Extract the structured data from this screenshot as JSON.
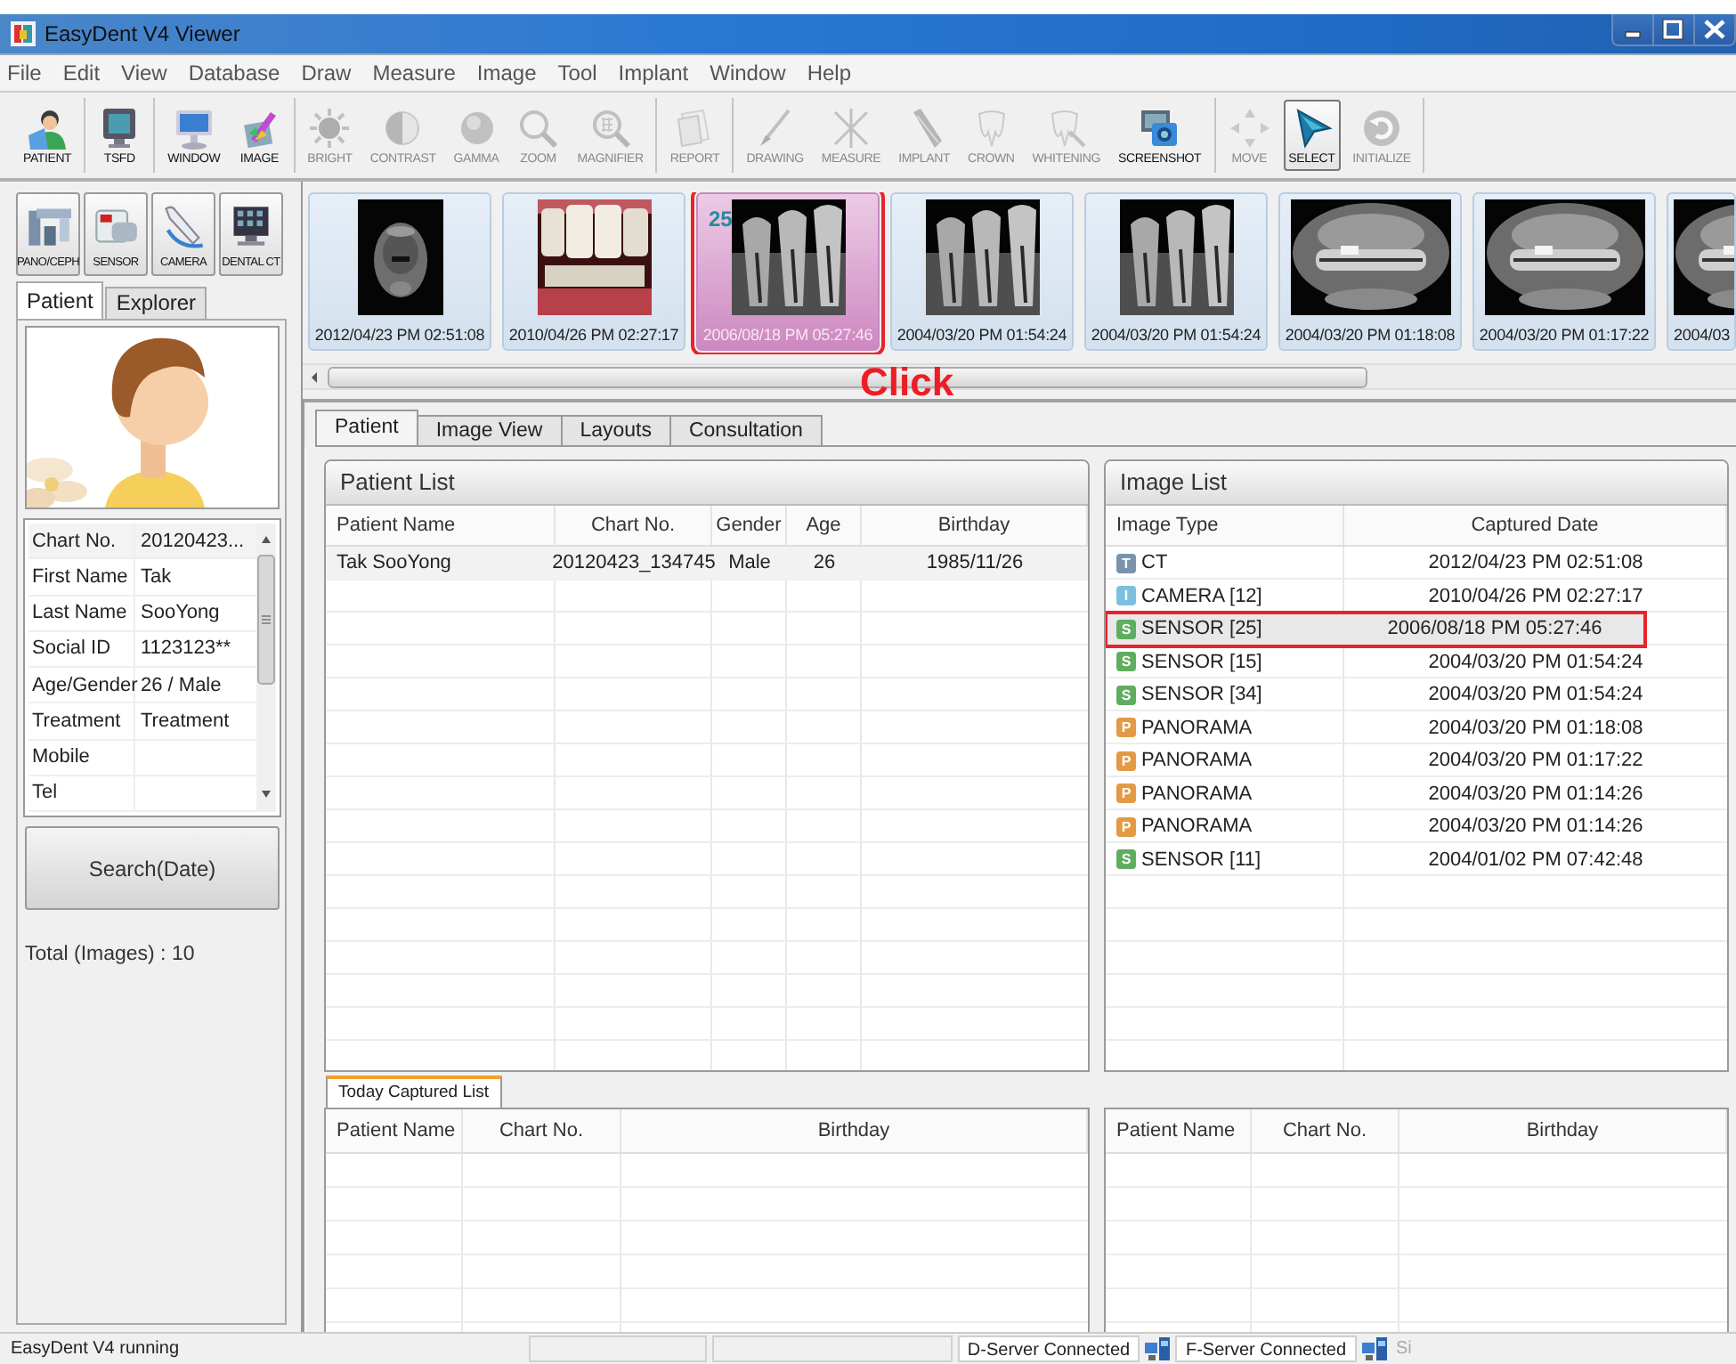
{
  "window": {
    "title": "EasyDent V4 Viewer"
  },
  "menu": [
    "File",
    "Edit",
    "View",
    "Database",
    "Draw",
    "Measure",
    "Image",
    "Tool",
    "Implant",
    "Window",
    "Help"
  ],
  "toolbar": {
    "groups": [
      [
        {
          "label": "PATIENT",
          "disabled": false,
          "selected": false
        }
      ],
      [
        {
          "label": "TSFD",
          "disabled": false,
          "selected": false
        }
      ],
      [
        {
          "label": "WINDOW",
          "disabled": false,
          "selected": false
        },
        {
          "label": "IMAGE",
          "disabled": false,
          "selected": false
        }
      ],
      [
        {
          "label": "BRIGHT",
          "disabled": true,
          "selected": false
        },
        {
          "label": "CONTRAST",
          "disabled": true,
          "selected": false
        },
        {
          "label": "GAMMA",
          "disabled": true,
          "selected": false
        },
        {
          "label": "ZOOM",
          "disabled": true,
          "selected": false
        },
        {
          "label": "MAGNIFIER",
          "disabled": true,
          "selected": false
        }
      ],
      [
        {
          "label": "REPORT",
          "disabled": true,
          "selected": false
        }
      ],
      [
        {
          "label": "DRAWING",
          "disabled": true,
          "selected": false
        },
        {
          "label": "MEASURE",
          "disabled": true,
          "selected": false
        },
        {
          "label": "IMPLANT",
          "disabled": true,
          "selected": false
        },
        {
          "label": "CROWN",
          "disabled": true,
          "selected": false
        },
        {
          "label": "WHITENING",
          "disabled": true,
          "selected": false
        },
        {
          "label": "SCREENSHOT",
          "disabled": false,
          "selected": false
        }
      ],
      [
        {
          "label": "MOVE",
          "disabled": true,
          "selected": false
        },
        {
          "label": "SELECT",
          "disabled": false,
          "selected": true
        },
        {
          "label": "INITIALIZE",
          "disabled": true,
          "selected": false
        }
      ]
    ]
  },
  "devices": [
    "PANO/CEPH",
    "SENSOR",
    "CAMERA",
    "DENTAL CT"
  ],
  "left_tabs": [
    {
      "label": "Patient",
      "selected": true
    },
    {
      "label": "Explorer",
      "selected": false
    }
  ],
  "patient_info": [
    {
      "field": "Chart No.",
      "value": "20120423..."
    },
    {
      "field": "First Name",
      "value": "Tak"
    },
    {
      "field": "Last Name",
      "value": "SooYong"
    },
    {
      "field": "Social ID",
      "value": "1123123**"
    },
    {
      "field": "Age/Gender",
      "value": "26 / Male"
    },
    {
      "field": "Treatment",
      "value": "Treatment"
    },
    {
      "field": "Mobile"
    },
    {
      "field": "Tel"
    }
  ],
  "search_button": "Search(Date)",
  "total": "Total (Images) : 10",
  "thumbnails": [
    {
      "kind": "ct",
      "date": "2012/04/23 PM 02:51:08",
      "selected": false,
      "highlighted": false
    },
    {
      "date": "2010/04/26 PM 02:27:17",
      "selected": false,
      "highlighted": false
    },
    {
      "kind": "periapical",
      "badge": "25",
      "date": "2006/08/18 PM 05:27:46",
      "selected": true,
      "highlighted": true
    },
    {
      "kind": "periapical",
      "date": "2004/03/20 PM 01:54:24",
      "selected": false,
      "highlighted": false
    },
    {
      "kind": "periapical",
      "date": "2004/03/20 PM 01:54:24",
      "selected": false,
      "highlighted": false
    },
    {
      "kind": "panorama",
      "date": "2004/03/20 PM 01:18:08",
      "selected": false,
      "highlighted": false
    },
    {
      "kind": "panorama",
      "date": "2004/03/20 PM 01:17:22",
      "selected": false,
      "highlighted": false
    },
    {
      "kind": "panorama",
      "date": "2004/03",
      "selected": false,
      "highlighted": false
    }
  ],
  "click_label": "Click",
  "tabs": [
    {
      "label": "Patient",
      "selected": true
    },
    {
      "label": "Image View",
      "selected": false
    },
    {
      "label": "Layouts",
      "selected": false
    },
    {
      "label": "Consultation",
      "selected": false
    }
  ],
  "patient_list": {
    "title": "Patient List",
    "columns": [
      "Patient Name",
      "Chart No.",
      "Gender",
      "Age",
      "Birthday"
    ],
    "rows": [
      [
        "Tak SooYong",
        "20120423_134745",
        "Male",
        "26",
        "1985/11/26"
      ]
    ]
  },
  "image_list": {
    "title": "Image List",
    "columns": [
      "Image Type",
      "Captured Date"
    ],
    "rows": [
      {
        "letter": "T",
        "color": "#7a93ad",
        "type": "CT",
        "date": "2012/04/23 PM 02:51:08",
        "selected": false,
        "highlighted": false
      },
      {
        "letter": "I",
        "color": "#7cc0e0",
        "type": "CAMERA [12]",
        "date": "2010/04/26 PM 02:27:17",
        "selected": false,
        "highlighted": false
      },
      {
        "letter": "S",
        "color": "#5fae5f",
        "type": "SENSOR [25]",
        "date": "2006/08/18 PM 05:27:46",
        "selected": true,
        "highlighted": true
      },
      {
        "letter": "S",
        "color": "#5fae5f",
        "type": "SENSOR [15]",
        "date": "2004/03/20 PM 01:54:24",
        "selected": false,
        "highlighted": false
      },
      {
        "letter": "S",
        "color": "#5fae5f",
        "type": "SENSOR [34]",
        "date": "2004/03/20 PM 01:54:24",
        "selected": false,
        "highlighted": false
      },
      {
        "letter": "P",
        "color": "#e39a45",
        "type": "PANORAMA",
        "date": "2004/03/20 PM 01:18:08",
        "selected": false,
        "highlighted": false
      },
      {
        "letter": "P",
        "color": "#e39a45",
        "type": "PANORAMA",
        "date": "2004/03/20 PM 01:17:22",
        "selected": false,
        "highlighted": false
      },
      {
        "letter": "P",
        "color": "#e39a45",
        "type": "PANORAMA",
        "date": "2004/03/20 PM 01:14:26",
        "selected": false,
        "highlighted": false
      },
      {
        "letter": "P",
        "color": "#e39a45",
        "type": "PANORAMA",
        "date": "2004/03/20 PM 01:14:26",
        "selected": false,
        "highlighted": false
      },
      {
        "letter": "S",
        "color": "#5fae5f",
        "type": "SENSOR [11]",
        "date": "2004/01/02 PM 07:42:48",
        "selected": false,
        "highlighted": false
      }
    ]
  },
  "today_tab": {
    "label": "Today Captured List",
    "selected": true
  },
  "today_list": {
    "columns": [
      "Patient Name",
      "Chart No.",
      "Birthday"
    ]
  },
  "right_lower_list": {
    "columns": [
      "Patient Name",
      "Chart No.",
      "Birthday"
    ]
  },
  "status_bar": {
    "message": "EasyDent V4 running",
    "d_server": "D-Server Connected",
    "f_server": "F-Server Connected",
    "extra": "Si"
  }
}
